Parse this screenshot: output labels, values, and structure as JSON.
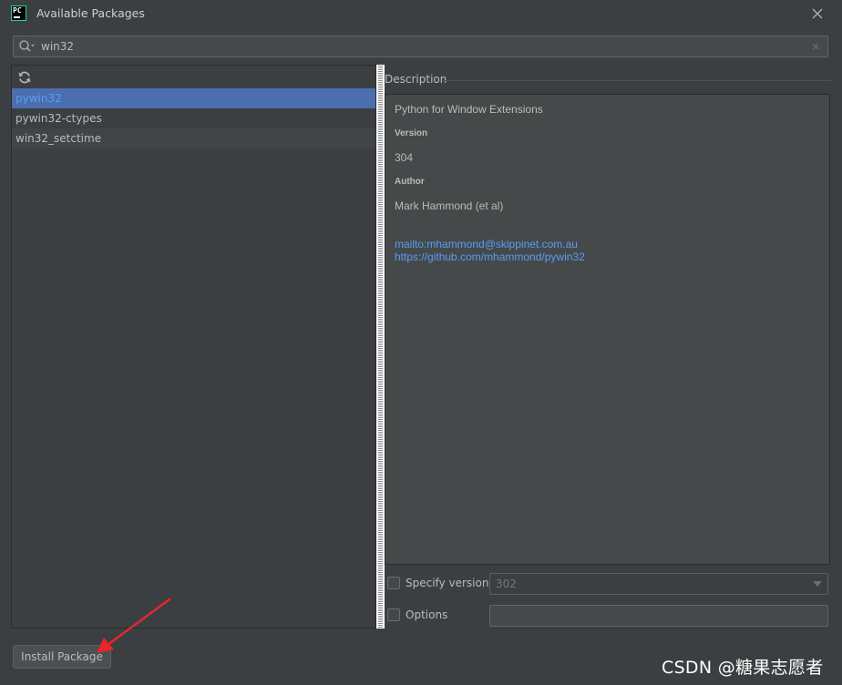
{
  "window": {
    "app_icon_text": "PC",
    "title": "Available Packages"
  },
  "search": {
    "value": "win32"
  },
  "packages": [
    {
      "name": "pywin32",
      "selected": true
    },
    {
      "name": "pywin32-ctypes",
      "selected": false
    },
    {
      "name": "win32_setctime",
      "selected": false
    }
  ],
  "description": {
    "header": "Description",
    "summary": "Python for Window Extensions",
    "version_label": "Version",
    "version": "304",
    "author_label": "Author",
    "author": "Mark Hammond (et al)",
    "links": [
      "mailto:mhammond@skippinet.com.au",
      "https://github.com/mhammond/pywin32"
    ]
  },
  "options": {
    "specify_version_label": "Specify version",
    "specify_version_checked": false,
    "version_value": "302",
    "options_label": "Options",
    "options_checked": false,
    "options_value": ""
  },
  "actions": {
    "install_label": "Install Package"
  },
  "watermark": "CSDN @糖果志愿者",
  "colors": {
    "background": "#3c3f41",
    "selection": "#4b6eaf",
    "link": "#589df6",
    "annotation_arrow": "#e8262b"
  },
  "icons": [
    "pycharm-logo",
    "close-icon",
    "search-icon",
    "clear-icon",
    "refresh-icon",
    "chevron-down-icon"
  ]
}
